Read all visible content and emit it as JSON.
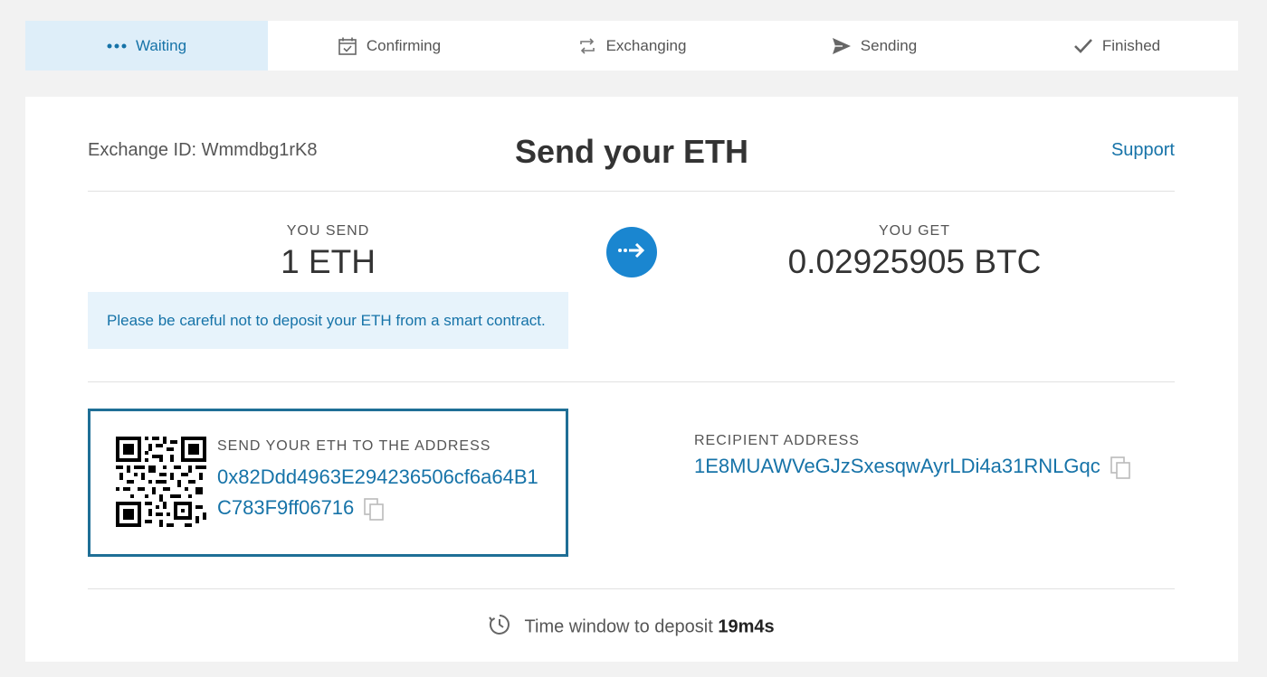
{
  "steps": [
    {
      "label": "Waiting",
      "icon": "dots-icon",
      "active": true
    },
    {
      "label": "Confirming",
      "icon": "calendar-check-icon",
      "active": false
    },
    {
      "label": "Exchanging",
      "icon": "exchange-arrows-icon",
      "active": false
    },
    {
      "label": "Sending",
      "icon": "send-plane-icon",
      "active": false
    },
    {
      "label": "Finished",
      "icon": "checkmark-icon",
      "active": false
    }
  ],
  "header": {
    "exchange_id": "Exchange ID: Wmmdbg1rK8",
    "title": "Send your ETH",
    "support_label": "Support"
  },
  "send": {
    "label": "YOU SEND",
    "amount": "1 ETH"
  },
  "get": {
    "label": "YOU GET",
    "amount": "0.02925905 BTC"
  },
  "warning": "Please be careful not to deposit your ETH from a smart contract.",
  "deposit": {
    "label": "SEND YOUR ETH TO THE ADDRESS",
    "address": "0x82Ddd4963E294236506cf6a64B1C783F9ff06716"
  },
  "recipient": {
    "label": "RECIPIENT ADDRESS",
    "address": "1E8MUAWVeGJzSxesqwAyrLDi4a31RNLGqc"
  },
  "timer": {
    "label": "Time window to deposit",
    "value": "19m4s"
  },
  "colors": {
    "accent": "#1673a8",
    "arrow_button": "#1a86d0",
    "active_step_bg": "#deeef9",
    "warning_bg": "#e7f3fb",
    "deposit_border": "#1f6f96"
  }
}
